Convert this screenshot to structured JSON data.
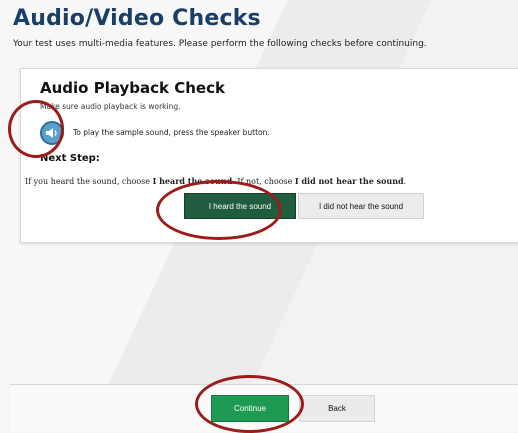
{
  "page": {
    "title": "Audio/Video Checks",
    "subtitle": "Your test uses multi-media features. Please perform the following checks before continuing."
  },
  "card": {
    "title": "Audio Playback Check",
    "intro": "Make sure audio playback is working.",
    "speaker_instruction": "To play the sample sound, press the speaker button.",
    "next_step_heading": "Next Step:",
    "instructions": {
      "part1": "If you heard the sound, choose ",
      "heard_bold": "I heard the sound",
      "part2": ". If not, choose ",
      "not_heard_bold": "I did not hear the sound",
      "part3": "."
    },
    "speaker_icon": "speaker-icon",
    "heard_button_label": "I heard the sound",
    "not_heard_button_label": "I did not hear the sound"
  },
  "footer": {
    "continue_label": "Continue",
    "back_label": "Back"
  },
  "colors": {
    "title": "#1a3f66",
    "heard_button": "#1f5d3e",
    "continue_button": "#1e9a52",
    "annotation": "#9c1b1b"
  }
}
